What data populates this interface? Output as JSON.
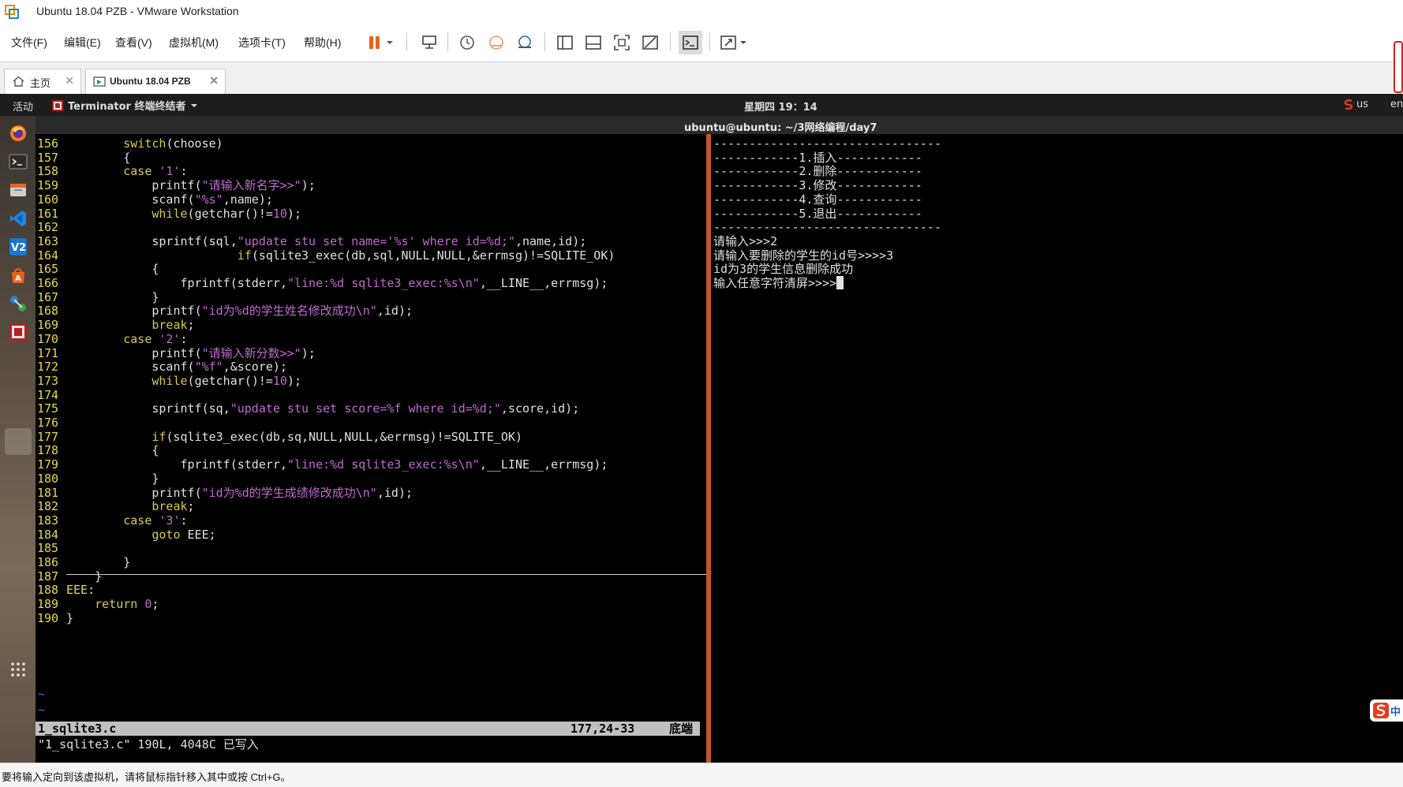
{
  "window": {
    "title": "Ubuntu 18.04 PZB - VMware Workstation"
  },
  "menubar": {
    "items": [
      "文件(F)",
      "编辑(E)",
      "查看(V)",
      "虚拟机(M)",
      "选项卡(T)",
      "帮助(H)"
    ]
  },
  "tabs": [
    {
      "label": "主页",
      "icon": "home-icon",
      "active": false
    },
    {
      "label": "Ubuntu 18.04 PZB",
      "icon": "vm-icon",
      "active": true
    }
  ],
  "ubuntu": {
    "activities": "活动",
    "app_name": "Terminator 终端终结者",
    "clock": "星期四 19：14",
    "keyboard": "us",
    "lang": "en",
    "terminal_title": "ubuntu@ubuntu: ~/3网络编程/day7"
  },
  "dock": [
    "firefox-icon",
    "terminal-icon",
    "files-icon",
    "vscode-icon",
    "vim-icon",
    "software-center-icon",
    "network-icon",
    "terminator-icon",
    "apps-grid-icon"
  ],
  "vim": {
    "lines": [
      {
        "n": "156",
        "code": "        switch(choose)"
      },
      {
        "n": "157",
        "code": "        {"
      },
      {
        "n": "158",
        "code": "        case '1':"
      },
      {
        "n": "159",
        "code": "            printf(\"请输入新名字>>\");"
      },
      {
        "n": "160",
        "code": "            scanf(\"%s\",name);"
      },
      {
        "n": "161",
        "code": "            while(getchar()!=10);"
      },
      {
        "n": "162",
        "code": ""
      },
      {
        "n": "163",
        "code": "            sprintf(sql,\"update stu set name='%s' where id=%d;\",name,id);"
      },
      {
        "n": "164",
        "code": "                        if(sqlite3_exec(db,sql,NULL,NULL,&errmsg)!=SQLITE_OK)"
      },
      {
        "n": "165",
        "code": "            {"
      },
      {
        "n": "166",
        "code": "                fprintf(stderr,\"line:%d sqlite3_exec:%s\\n\",__LINE__,errmsg);"
      },
      {
        "n": "167",
        "code": "            }"
      },
      {
        "n": "168",
        "code": "            printf(\"id为%d的学生姓名修改成功\\n\",id);"
      },
      {
        "n": "169",
        "code": "            break;"
      },
      {
        "n": "170",
        "code": "        case '2':"
      },
      {
        "n": "171",
        "code": "            printf(\"请输入新分数>>\");"
      },
      {
        "n": "172",
        "code": "            scanf(\"%f\",&score);"
      },
      {
        "n": "173",
        "code": "            while(getchar()!=10);"
      },
      {
        "n": "174",
        "code": ""
      },
      {
        "n": "175",
        "code": "            sprintf(sq,\"update stu set score=%f where id=%d;\",score,id);"
      },
      {
        "n": "176",
        "code": ""
      },
      {
        "n": "177",
        "code": "            if(sqlite3_exec(db,sq,NULL,NULL,&errmsg)!=SQLITE_OK)"
      },
      {
        "n": "178",
        "code": "            {"
      },
      {
        "n": "179",
        "code": "                fprintf(stderr,\"line:%d sqlite3_exec:%s\\n\",__LINE__,errmsg);"
      },
      {
        "n": "180",
        "code": "            }"
      },
      {
        "n": "181",
        "code": "            printf(\"id为%d的学生成绩修改成功\\n\",id);"
      },
      {
        "n": "182",
        "code": "            break;"
      },
      {
        "n": "183",
        "code": "        case '3':"
      },
      {
        "n": "184",
        "code": "            goto EEE;"
      },
      {
        "n": "185",
        "code": ""
      },
      {
        "n": "186",
        "code": "        }"
      },
      {
        "n": "187",
        "code": "    }"
      },
      {
        "n": "188",
        "code": "EEE:"
      },
      {
        "n": "189",
        "code": "    return 0;"
      },
      {
        "n": "190",
        "code": "}"
      }
    ],
    "tilde": "~",
    "status_file": "1_sqlite3.c",
    "status_pos": "177,24-33",
    "status_pct": "底端",
    "message": "\"1_sqlite3.c\" 190L, 4048C 已写入"
  },
  "right_terminal": {
    "lines": [
      "--------------------------------",
      "------------1.插入------------",
      "------------2.删除------------",
      "------------3.修改------------",
      "------------4.查询------------",
      "------------5.退出------------",
      "--------------------------------",
      "请输入>>>2",
      "请输入要删除的学生的id号>>>>3",
      "id为3的学生信息删除成功",
      "输入任意字符清屏>>>>"
    ]
  },
  "ime": {
    "label": "中"
  },
  "statusbar": {
    "text": "要将输入定向到该虚拟机，请将鼠标指针移入其中或按 Ctrl+G。"
  },
  "colors": {
    "splitter": "#c0562a",
    "line_number": "#e6d84a",
    "string": "#c06ad0"
  }
}
